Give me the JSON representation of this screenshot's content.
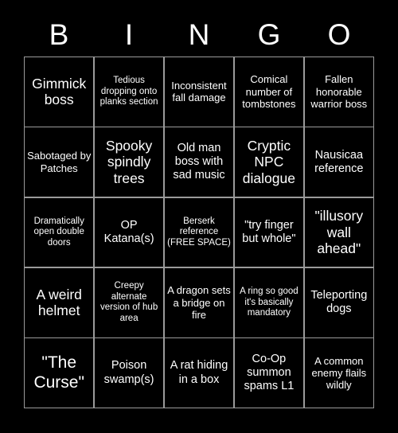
{
  "header": {
    "letters": [
      "B",
      "I",
      "N",
      "G",
      "O"
    ]
  },
  "colors": {
    "background": "#000000",
    "text": "#ffffff",
    "grid_line": "#9a9a9a"
  },
  "grid": {
    "columns": 5,
    "rows": 5,
    "free_space_cell": "Berserk reference (FREE SPACE)",
    "cells": [
      {
        "text": "Gimmick boss",
        "size": "l"
      },
      {
        "text": "Tedious dropping onto planks section",
        "size": "xs"
      },
      {
        "text": "Inconsistent fall damage",
        "size": "s"
      },
      {
        "text": "Comical number of tombstones",
        "size": "s"
      },
      {
        "text": "Fallen honorable warrior boss",
        "size": "s"
      },
      {
        "text": "Sabotaged by Patches",
        "size": "s"
      },
      {
        "text": "Spooky spindly trees",
        "size": "l"
      },
      {
        "text": "Old man boss with sad music",
        "size": "m"
      },
      {
        "text": "Cryptic NPC dialogue",
        "size": "l"
      },
      {
        "text": "Nausicaa reference",
        "size": "m"
      },
      {
        "text": "Dramatically open double doors",
        "size": "xs"
      },
      {
        "text": "OP Katana(s)",
        "size": "m"
      },
      {
        "text": "Berserk reference (FREE SPACE)",
        "size": "xs"
      },
      {
        "text": "\"try finger but whole\"",
        "size": "m"
      },
      {
        "text": "\"illusory wall ahead\"",
        "size": "l"
      },
      {
        "text": "A weird helmet",
        "size": "l"
      },
      {
        "text": "Creepy alternate version of hub area",
        "size": "xs"
      },
      {
        "text": "A dragon sets a bridge on fire",
        "size": "s"
      },
      {
        "text": "A ring so good it's basically mandatory",
        "size": "xs"
      },
      {
        "text": "Teleporting dogs",
        "size": "m"
      },
      {
        "text": "\"The Curse\"",
        "size": "xl"
      },
      {
        "text": "Poison swamp(s)",
        "size": "m"
      },
      {
        "text": "A rat hiding in a box",
        "size": "m"
      },
      {
        "text": "Co-Op summon spams L1",
        "size": "m"
      },
      {
        "text": "A common enemy flails wildly",
        "size": "s"
      }
    ]
  }
}
